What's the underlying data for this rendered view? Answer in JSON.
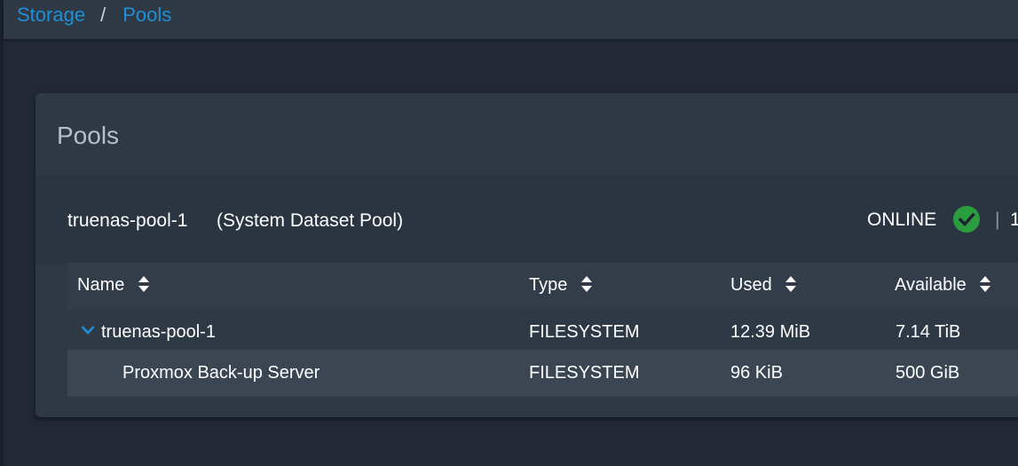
{
  "breadcrumb": {
    "items": [
      "Storage",
      "Pools"
    ],
    "separator": "/"
  },
  "card": {
    "title": "Pools"
  },
  "pool": {
    "name": "truenas-pool-1",
    "subtitle": "(System Dataset Pool)",
    "status": "ONLINE",
    "status_icon": "check-circle-icon",
    "status_color": "#2a9d3f",
    "divider": "|",
    "extra": "1"
  },
  "table": {
    "columns": [
      "Name",
      "Type",
      "Used",
      "Available"
    ],
    "rows": [
      {
        "name": "truenas-pool-1",
        "type": "FILESYSTEM",
        "used": "12.39 MiB",
        "available": "7.14 TiB",
        "expandable": true,
        "expanded": true
      },
      {
        "name": "Proxmox Back-up Server",
        "type": "FILESYSTEM",
        "used": "96 KiB",
        "available": "500 GiB",
        "expandable": false
      }
    ]
  },
  "colors": {
    "accent": "#1f8fd6",
    "background": "#222935",
    "card": "#2e3945",
    "selected_row": "#3b4652"
  }
}
